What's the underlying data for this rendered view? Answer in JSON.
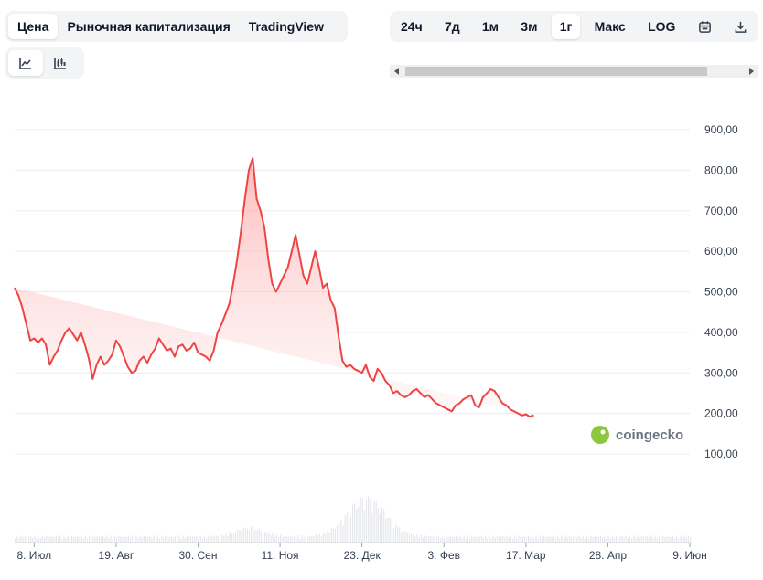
{
  "tabs": [
    {
      "label": "Цена",
      "active": true
    },
    {
      "label": "Рыночная капитализация",
      "active": false
    },
    {
      "label": "TradingView",
      "active": false
    }
  ],
  "chart_type_buttons": [
    {
      "icon": "line-chart-icon",
      "active": true
    },
    {
      "icon": "candlestick-chart-icon",
      "active": false
    }
  ],
  "ranges": [
    {
      "label": "24ч",
      "active": false
    },
    {
      "label": "7д",
      "active": false
    },
    {
      "label": "1м",
      "active": false
    },
    {
      "label": "3м",
      "active": false
    },
    {
      "label": "1г",
      "active": true
    },
    {
      "label": "Макс",
      "active": false
    },
    {
      "label": "LOG",
      "active": false
    }
  ],
  "toolbar_icons": [
    "calendar-icon",
    "download-icon"
  ],
  "watermark": "coingecko",
  "colors": {
    "line": "#ef4444",
    "fill_top": "#fca5a5",
    "volume": "#e5e7eb",
    "grid": "#ececec",
    "accent_logo": "#8dc63f"
  },
  "chart_data": {
    "type": "area",
    "y_tick_labels": [
      "100,00",
      "200,00",
      "300,00",
      "400,00",
      "500,00",
      "600,00",
      "700,00",
      "800,00",
      "900,00"
    ],
    "y_ticks": [
      100,
      200,
      300,
      400,
      500,
      600,
      700,
      800,
      900
    ],
    "ylim": [
      100,
      900
    ],
    "x_tick_labels": [
      "8. Июл",
      "19. Авг",
      "30. Сен",
      "11. Ноя",
      "23. Дек",
      "3. Фев",
      "17. Мар",
      "28. Апр",
      "9. Июн"
    ],
    "x_tick_days": [
      10,
      52,
      94,
      136,
      178,
      220,
      262,
      304,
      346
    ],
    "xlim": [
      0,
      346
    ],
    "grid": true,
    "series": [
      {
        "days": [
          0,
          2,
          4,
          6,
          8,
          10,
          12,
          14,
          16,
          18,
          20,
          22,
          24,
          26,
          28,
          30,
          32,
          34,
          36,
          38,
          40,
          42,
          44,
          46,
          48,
          50,
          52,
          54,
          56,
          58,
          60,
          62,
          64,
          66,
          68,
          70,
          72,
          74,
          76,
          78,
          80,
          82,
          84,
          86,
          88,
          90,
          92,
          94,
          96,
          98,
          100,
          102,
          104,
          106,
          108,
          110,
          112,
          114,
          116,
          118,
          120,
          122,
          124,
          126,
          128,
          130,
          132,
          134,
          136,
          138,
          140,
          142,
          144,
          146,
          148,
          150,
          152,
          154,
          156,
          158,
          160,
          162,
          164,
          166,
          168,
          170,
          172,
          174,
          176,
          178,
          180,
          182,
          184,
          186,
          188,
          190,
          192,
          194,
          196,
          198,
          200,
          202,
          204,
          206,
          208,
          210,
          212,
          214,
          216,
          218,
          220,
          222,
          224,
          226,
          228,
          230,
          232,
          234,
          236,
          238,
          240,
          242,
          244,
          246,
          248,
          250,
          252,
          254,
          256,
          258,
          260,
          262,
          264,
          266,
          268,
          270,
          272,
          274,
          276,
          278,
          280,
          282,
          284,
          286,
          288,
          290,
          292,
          294,
          296,
          298,
          300,
          302,
          304,
          306,
          308,
          310,
          312,
          314,
          316,
          318,
          320,
          322,
          324,
          326,
          328,
          330,
          332,
          334,
          336,
          338,
          340,
          342,
          344,
          346
        ],
        "values": [
          510,
          490,
          460,
          420,
          380,
          385,
          375,
          385,
          370,
          320,
          340,
          355,
          380,
          400,
          410,
          395,
          380,
          400,
          370,
          335,
          285,
          320,
          340,
          320,
          330,
          345,
          380,
          365,
          340,
          315,
          300,
          305,
          330,
          340,
          325,
          345,
          360,
          385,
          370,
          355,
          360,
          340,
          365,
          370,
          355,
          360,
          375,
          350,
          345,
          340,
          330,
          355,
          400,
          420,
          445,
          470,
          520,
          580,
          650,
          730,
          800,
          830,
          730,
          700,
          660,
          580,
          520,
          500,
          520,
          540,
          560,
          600,
          640,
          590,
          540,
          520,
          560,
          600,
          560,
          510,
          520,
          480,
          460,
          390,
          330,
          315,
          320,
          310,
          305,
          300,
          320,
          290,
          280,
          310,
          300,
          280,
          270,
          250,
          255,
          245,
          240,
          245,
          255,
          260,
          250,
          240,
          245,
          235,
          225,
          220,
          215,
          210,
          205,
          220,
          225,
          235,
          240,
          245,
          220,
          215,
          240,
          250,
          260,
          255,
          240,
          225,
          220,
          210,
          205,
          200,
          195,
          198,
          192,
          196
        ],
        "note": "Price series sampled every 2 days of the 1-year view"
      }
    ],
    "volume": {
      "note": "Relative volume bars at chart bottom; peak near mid-December",
      "peak_day": 180
    }
  }
}
